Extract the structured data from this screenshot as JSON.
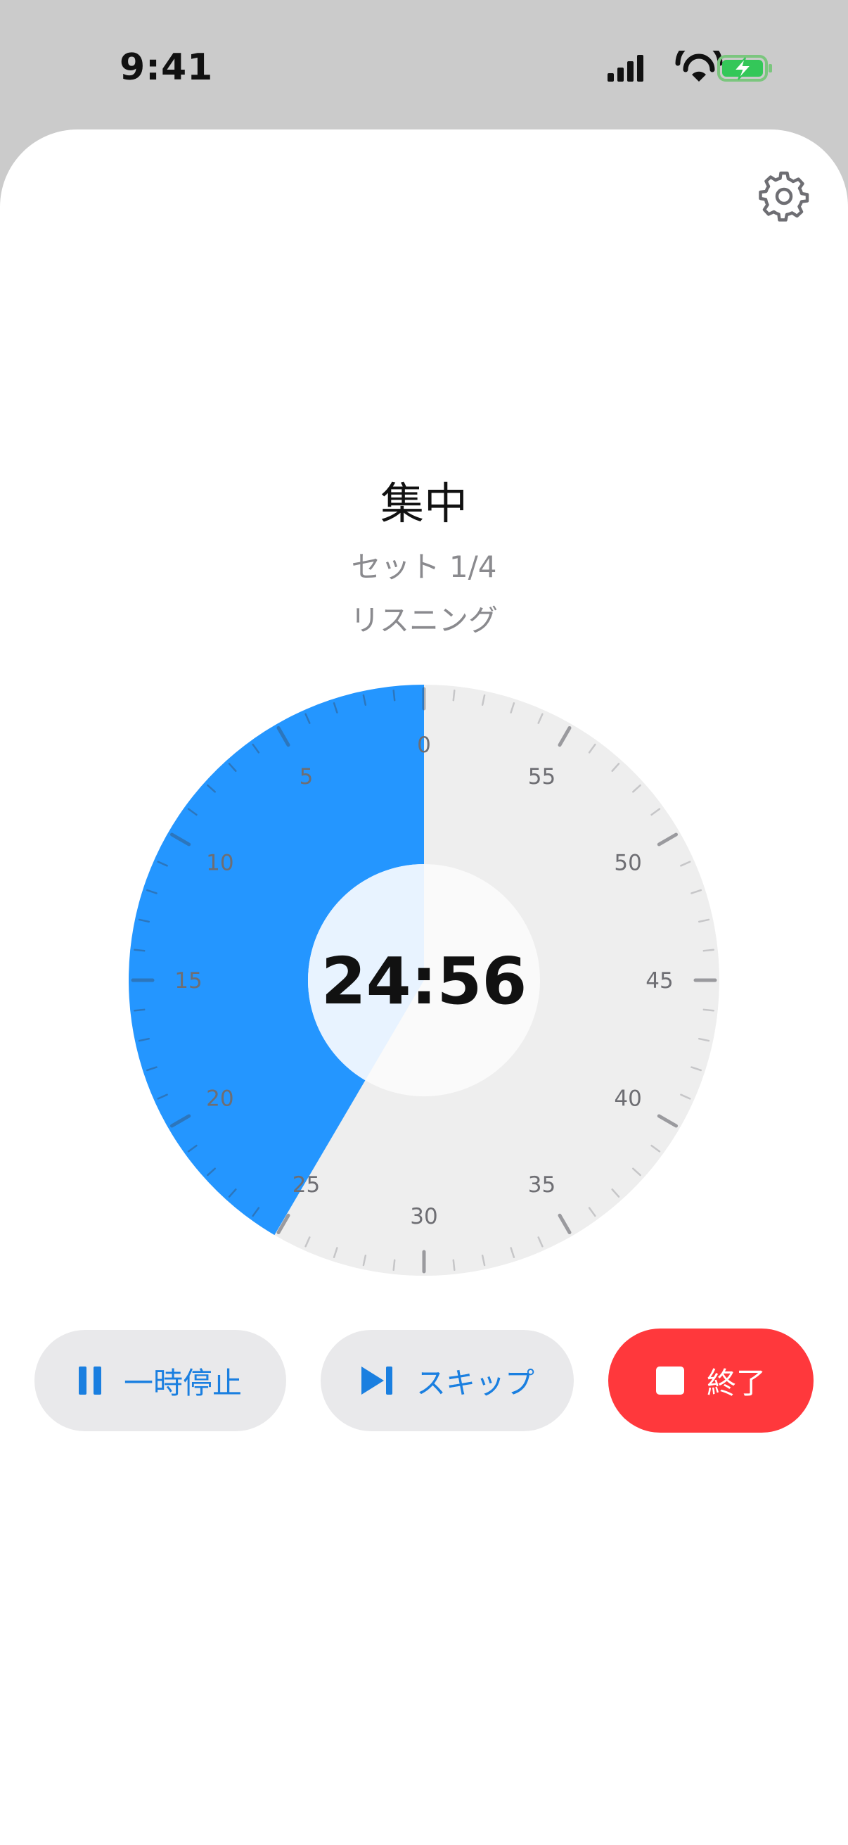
{
  "status_bar": {
    "time": "9:41",
    "icons": [
      "signal-icon",
      "wifi-icon",
      "battery-charging-icon"
    ]
  },
  "header": {
    "settings_icon": "gear-icon"
  },
  "session": {
    "title": "集中",
    "set_label": "セット 1/4",
    "activity": "リスニング"
  },
  "timer": {
    "remaining": "24:56",
    "dial_labels": [
      "0",
      "5",
      "10",
      "15",
      "20",
      "25",
      "30",
      "35",
      "40",
      "45",
      "50",
      "55"
    ],
    "remaining_minutes": 24.93,
    "total_minutes": 60,
    "colors": {
      "remaining": "#2496ff",
      "track": "#eeeeee",
      "center_active": "#e8f3ff",
      "center_idle": "#fafafa"
    }
  },
  "controls": {
    "pause_label": "一時停止",
    "skip_label": "スキップ",
    "end_label": "終了",
    "pause_icon": "pause-icon",
    "skip_icon": "skip-forward-icon",
    "end_icon": "stop-icon"
  }
}
